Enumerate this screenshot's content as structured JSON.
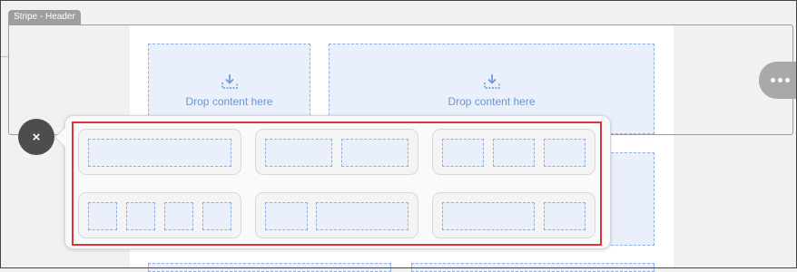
{
  "stripe": {
    "label": "Stripe - Header"
  },
  "drop_zones": [
    {
      "label": "Drop content here",
      "icon": "download-icon"
    },
    {
      "label": "Drop content here",
      "icon": "download-icon"
    }
  ],
  "controls": {
    "close_icon": "×",
    "more_icon": "more-horizontal-icon"
  },
  "layout_options": [
    {
      "name": "1 column",
      "columns": 1
    },
    {
      "name": "2 columns",
      "columns": 2
    },
    {
      "name": "3 columns",
      "columns": 3
    },
    {
      "name": "4 columns",
      "columns": 4
    },
    {
      "name": "1/3 + 2/3",
      "columns": 2
    },
    {
      "name": "2/3 + 1/3",
      "columns": 2
    }
  ],
  "colors": {
    "highlight": "#e0343c",
    "drop_zone_fill": "#e9f0fb",
    "drop_zone_border": "#8fb0de",
    "accent_text": "#6a95d3"
  }
}
